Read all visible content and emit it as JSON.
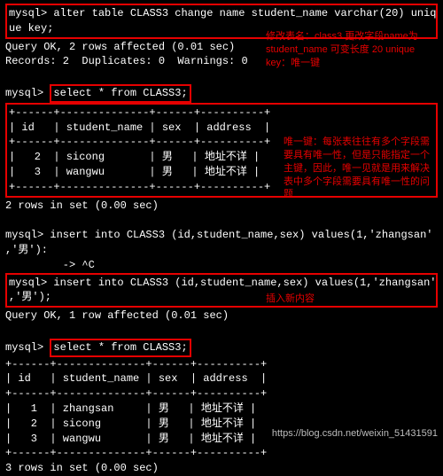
{
  "l1a": "mysql>",
  "l1b": "alter table CLASS3 change name student_name varchar(20) uniq",
  "l2": "ue key;",
  "l3": "Query OK, 2 rows affected (0.01 sec)",
  "l4": "Records: 2  Duplicates: 0  Warnings: 0",
  "blank": " ",
  "l6a": "mysql>",
  "l6b": "select * from CLASS3;",
  "sep": "+------+--------------+------+----------+",
  "hdr": "| id   | student_name | sex  | address  |",
  "r_sicong": "|   2  | sicong       | 男   | 地址不详 |",
  "r_wangwu": "|   3  | wangwu       | 男   | 地址不详 |",
  "set2": "2 rows in set (0.00 sec)",
  "ins1a": "mysql> insert into CLASS3 (id,student_name,sex) values(1,'zhangsan'",
  "ins1b": ",'男'):",
  "ctrl": "         -> ^C",
  "ins2a": "mysql>",
  "ins2b": "insert into CLASS3 (id,student_name,sex) values(1,'zhangsan'",
  "ins2c": ",'男');",
  "ok1": "Query OK, 1 row affected (0.01 sec)",
  "r_zhang": "|   1  | zhangsan     | 男   | 地址不详 |",
  "set3": "3 rows in set (0.00 sec)",
  "note1": "修改表名：class3 更改字段name为 student_name 可变长度 20 unique key：唯一键",
  "note2": "唯一键：每张表往往有多个字段需要具有唯一性，但是只能指定一个主键，因此，唯一见就是用来解决表中多个字段需要具有唯一性的问题",
  "note3": "插入新内容",
  "watermark": "https://blog.csdn.net/weixin_51431591",
  "chart_data": {
    "type": "table",
    "columns": [
      "id",
      "student_name",
      "sex",
      "address"
    ],
    "tables": [
      {
        "rows": [
          {
            "id": 2,
            "student_name": "sicong",
            "sex": "男",
            "address": "地址不详"
          },
          {
            "id": 3,
            "student_name": "wangwu",
            "sex": "男",
            "address": "地址不详"
          }
        ]
      },
      {
        "rows": [
          {
            "id": 1,
            "student_name": "zhangsan",
            "sex": "男",
            "address": "地址不详"
          },
          {
            "id": 2,
            "student_name": "sicong",
            "sex": "男",
            "address": "地址不详"
          },
          {
            "id": 3,
            "student_name": "wangwu",
            "sex": "男",
            "address": "地址不详"
          }
        ]
      }
    ]
  }
}
